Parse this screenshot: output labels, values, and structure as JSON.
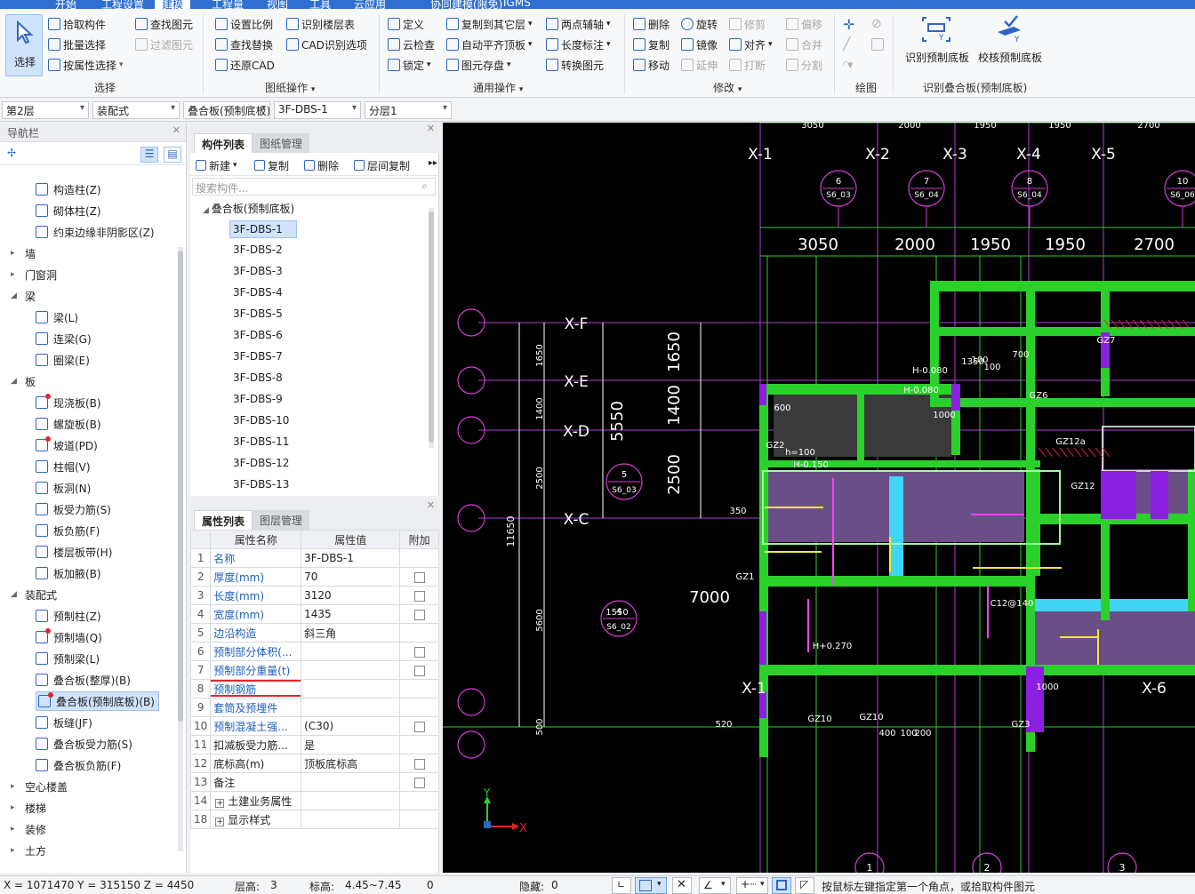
{
  "top_tabs": [
    "开始",
    "工程设置",
    "建模",
    "工程量",
    "视图",
    "工具",
    "云应用",
    "协同建模(限免)",
    "IGMS"
  ],
  "ribbon": {
    "select": "选择",
    "select_group": [
      "拾取构件",
      "批量选择",
      "按属性选择"
    ],
    "find_group": [
      "查找图元",
      "过滤图元"
    ],
    "group_select": "选择",
    "drawing_ops": [
      "设置比例",
      "识别楼层表",
      "查找替换",
      "CAD识别选项",
      "还原CAD"
    ],
    "group_drawing": "图纸操作",
    "general_ops": [
      "定义",
      "复制到其它层",
      "两点辅轴",
      "云检查",
      "自动平齐顶板",
      "长度标注",
      "锁定",
      "图元存盘",
      "转换图元"
    ],
    "group_general": "通用操作",
    "modify_ops": [
      "删除",
      "旋转",
      "修剪",
      "偏移",
      "复制",
      "镜像",
      "对齐",
      "合并",
      "移动",
      "延伸",
      "打断",
      "分割"
    ],
    "group_modify": "修改",
    "group_draw": "绘图",
    "recog_btns": [
      "识别预制底板",
      "校核预制底板"
    ],
    "group_recog": "识别叠合板(预制底板)"
  },
  "filters": [
    "第2层",
    "装配式",
    "叠合板(预制底板)",
    "3F-DBS-1",
    "分层1"
  ],
  "nav": {
    "title": "导航栏",
    "items": [
      {
        "type": "item",
        "label": "构造柱(Z)"
      },
      {
        "type": "item",
        "label": "砌体柱(Z)"
      },
      {
        "type": "item",
        "label": "约束边缘非阴影区(Z)"
      },
      {
        "type": "group",
        "label": "墙",
        "open": false
      },
      {
        "type": "group",
        "label": "门窗洞",
        "open": false
      },
      {
        "type": "group",
        "label": "梁",
        "open": true
      },
      {
        "type": "item",
        "label": "梁(L)"
      },
      {
        "type": "item",
        "label": "连梁(G)"
      },
      {
        "type": "item",
        "label": "圈梁(E)"
      },
      {
        "type": "group",
        "label": "板",
        "open": true
      },
      {
        "type": "item",
        "label": "现浇板(B)",
        "dot": true
      },
      {
        "type": "item",
        "label": "螺旋板(B)"
      },
      {
        "type": "item",
        "label": "坡道(PD)",
        "dot": true
      },
      {
        "type": "item",
        "label": "柱帽(V)"
      },
      {
        "type": "item",
        "label": "板洞(N)"
      },
      {
        "type": "item",
        "label": "板受力筋(S)"
      },
      {
        "type": "item",
        "label": "板负筋(F)"
      },
      {
        "type": "item",
        "label": "楼层板带(H)"
      },
      {
        "type": "item",
        "label": "板加腋(B)"
      },
      {
        "type": "group",
        "label": "装配式",
        "open": true
      },
      {
        "type": "item",
        "label": "预制柱(Z)"
      },
      {
        "type": "item",
        "label": "预制墙(Q)",
        "dot": true
      },
      {
        "type": "item",
        "label": "预制梁(L)"
      },
      {
        "type": "item",
        "label": "叠合板(整厚)(B)"
      },
      {
        "type": "item",
        "label": "叠合板(预制底板)(B)",
        "dot": true,
        "selected": true
      },
      {
        "type": "item",
        "label": "板缝(JF)"
      },
      {
        "type": "item",
        "label": "叠合板受力筋(S)"
      },
      {
        "type": "item",
        "label": "叠合板负筋(F)"
      },
      {
        "type": "group",
        "label": "空心楼盖",
        "open": false
      },
      {
        "type": "group",
        "label": "楼梯",
        "open": false
      },
      {
        "type": "group",
        "label": "装修",
        "open": false
      },
      {
        "type": "group",
        "label": "土方",
        "open": false
      }
    ]
  },
  "component_panel": {
    "tabs": [
      "构件列表",
      "图纸管理"
    ],
    "actions": [
      "新建",
      "复制",
      "删除",
      "层间复制"
    ],
    "search_placeholder": "搜索构件...",
    "tree_root": "叠合板(预制底板)",
    "items": [
      "3F-DBS-1",
      "3F-DBS-2",
      "3F-DBS-3",
      "3F-DBS-4",
      "3F-DBS-5",
      "3F-DBS-6",
      "3F-DBS-7",
      "3F-DBS-8",
      "3F-DBS-9",
      "3F-DBS-10",
      "3F-DBS-11",
      "3F-DBS-12",
      "3F-DBS-13"
    ]
  },
  "property_panel": {
    "tabs": [
      "属性列表",
      "图层管理"
    ],
    "headers": [
      "属性名称",
      "属性值",
      "附加"
    ],
    "rows": [
      {
        "n": "1",
        "name": "名称",
        "value": "3F-DBS-1",
        "blue": true,
        "cb": false
      },
      {
        "n": "2",
        "name": "厚度(mm)",
        "value": "70",
        "blue": true,
        "cb": true
      },
      {
        "n": "3",
        "name": "长度(mm)",
        "value": "3120",
        "blue": true,
        "cb": true
      },
      {
        "n": "4",
        "name": "宽度(mm)",
        "value": "1435",
        "blue": true,
        "cb": true
      },
      {
        "n": "5",
        "name": "边沿构造",
        "value": "斜三角",
        "blue": true,
        "cb": false
      },
      {
        "n": "6",
        "name": "预制部分体积(...",
        "value": "",
        "blue": true,
        "cb": true
      },
      {
        "n": "7",
        "name": "预制部分重量(t)",
        "value": "",
        "blue": true,
        "cb": true
      },
      {
        "n": "8",
        "name": "预制钢筋",
        "value": "",
        "blue": true,
        "cb": false,
        "highlight": true
      },
      {
        "n": "9",
        "name": "套筒及预埋件",
        "value": "",
        "blue": true,
        "cb": false
      },
      {
        "n": "10",
        "name": "预制混凝土强...",
        "value": "(C30)",
        "blue": true,
        "cb": true
      },
      {
        "n": "11",
        "name": "扣减板受力筋...",
        "value": "是",
        "blue": false,
        "cb": false
      },
      {
        "n": "12",
        "name": "底标高(m)",
        "value": "顶板底标高",
        "blue": false,
        "cb": true
      },
      {
        "n": "13",
        "name": "备注",
        "value": "",
        "blue": false,
        "cb": true
      },
      {
        "n": "14",
        "name": "土建业务属性",
        "value": "",
        "blue": false,
        "cb": false,
        "expand": true
      },
      {
        "n": "18",
        "name": "显示样式",
        "value": "",
        "blue": false,
        "cb": false,
        "expand": true
      }
    ]
  },
  "cad": {
    "axes_top": [
      "X-1",
      "X-2",
      "X-3",
      "X-4",
      "X-5"
    ],
    "dims_top": [
      "3050",
      "2000",
      "1950",
      "1950",
      "2700"
    ],
    "dims_top_small": [
      "3050",
      "2000",
      "1950",
      "1950",
      "2700"
    ],
    "circles_top": [
      {
        "n": "6",
        "s": "S6_03"
      },
      {
        "n": "7",
        "s": "S6_04"
      },
      {
        "n": "8",
        "s": "S6_04"
      },
      {
        "n": "10",
        "s": "S6_06"
      }
    ],
    "axes_left": [
      "X-F",
      "X-E",
      "X-D",
      "X-C"
    ],
    "dims_left_big": [
      "1650",
      "1400",
      "2500"
    ],
    "dim_total": "5550",
    "dims_left_small": [
      "1650",
      "1400",
      "2500",
      "5600",
      "500"
    ],
    "dim_11650": "11650",
    "circles_left": [
      {
        "n": "5",
        "s": "S6_03"
      },
      {
        "n": "4",
        "s": "S6_02"
      }
    ],
    "labels": [
      "7000",
      "1550",
      "C12@140",
      "1000",
      "H-0.080",
      "H-0.080",
      "GZ7",
      "GZ6",
      "GZ12a",
      "GZ1",
      "GZ10",
      "GZ10",
      "GZ3",
      "H+0.270",
      "400",
      "100",
      "200",
      "350",
      "520",
      "600",
      "1000",
      "700",
      "100",
      "100",
      "GZ2",
      "h=100",
      "H-0.150",
      "GZ12",
      "1350"
    ],
    "axis_x_label": "X",
    "axis_y_label": "Y",
    "bottom_axes": [
      "X-1",
      "X-6"
    ],
    "bottom_circles": [
      "1",
      "2",
      "3"
    ]
  },
  "status": {
    "coords": "X = 1071470 Y = 315150 Z = 4450",
    "floor_height_label": "层高:",
    "floor_height": "3",
    "elev_label": "标高:",
    "elev": "4.45~7.45",
    "zero": "0",
    "hidden_label": "隐藏:",
    "hidden": "0",
    "hint": "按鼠标左键指定第一个角点，或拾取构件图元"
  }
}
